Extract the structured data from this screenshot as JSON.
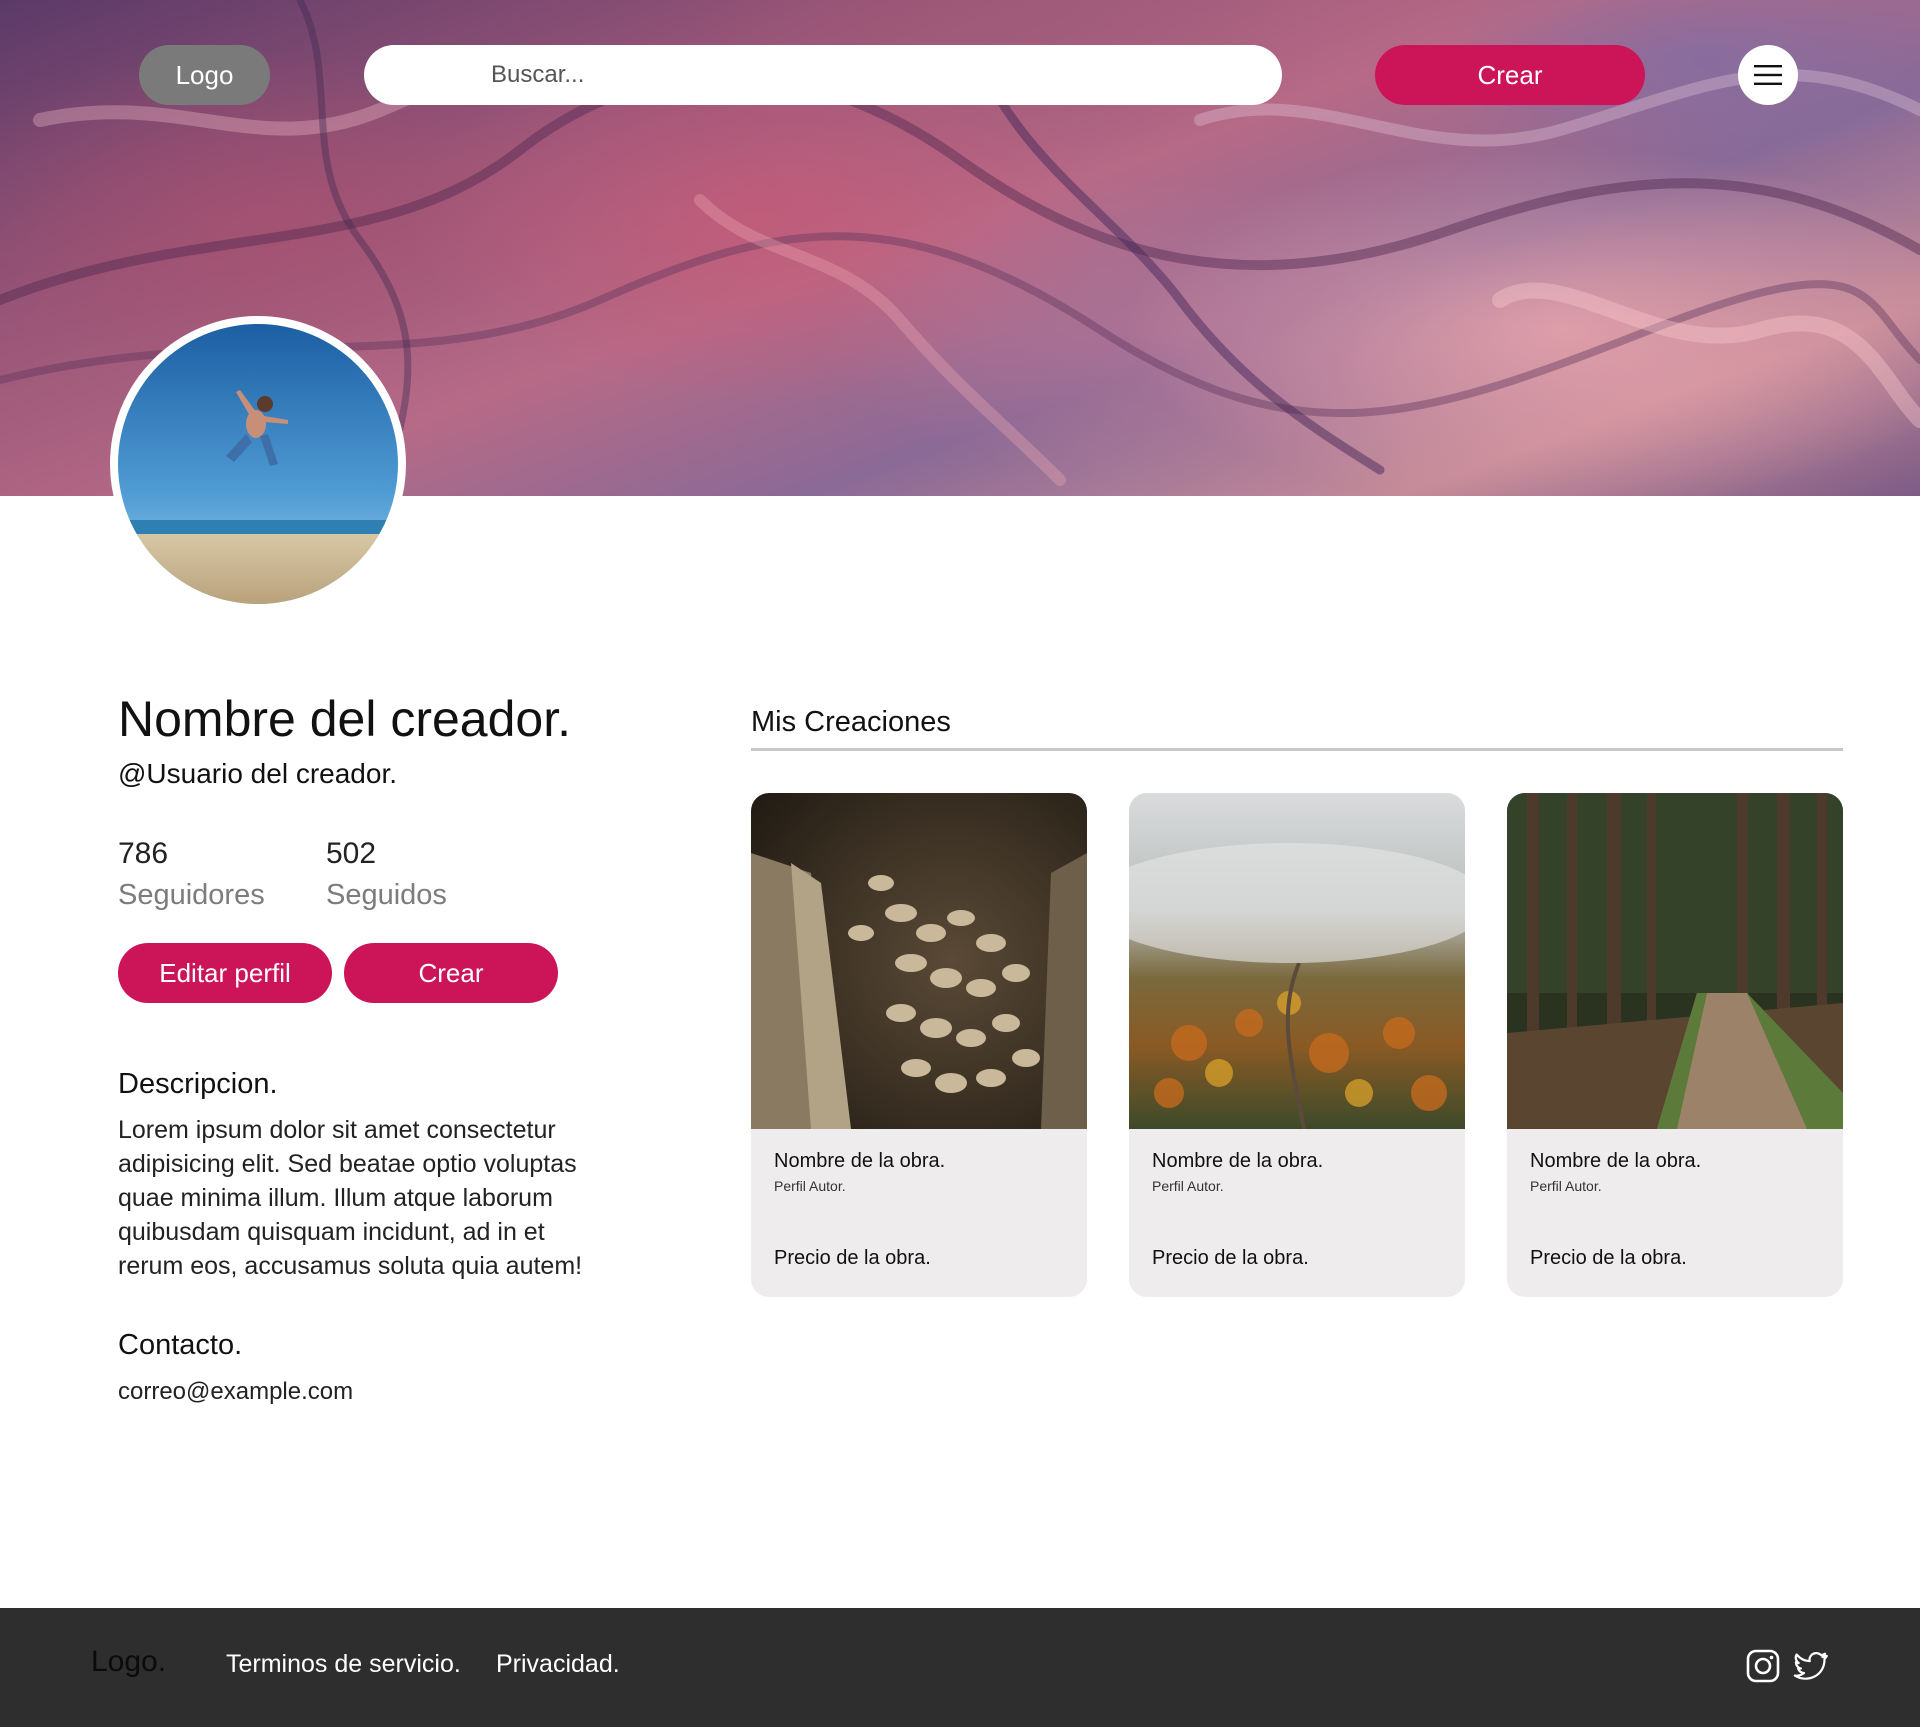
{
  "nav": {
    "logo": "Logo",
    "search_placeholder": "Buscar...",
    "create_label": "Crear",
    "menu_icon": "hamburger-icon"
  },
  "profile": {
    "name": "Nombre del creador.",
    "username": "@Usuario del creador.",
    "followers_count": "786",
    "followers_label": "Seguidores",
    "following_count": "502",
    "following_label": "Seguidos",
    "edit_button": "Editar perfil",
    "create_button": "Crear",
    "description_title": "Descripcion.",
    "description": "Lorem ipsum dolor sit amet consectetur adipisicing elit. Sed beatae optio voluptas quae minima illum. Illum atque laborum quibusdam quisquam incidunt, ad in et rerum eos, accusamus soluta quia autem!",
    "contact_title": "Contacto.",
    "email": "correo@example.com"
  },
  "creations": {
    "title": "Mis Creaciones",
    "cards": [
      {
        "title": "Nombre de la obra.",
        "author": "Perfil Autor.",
        "price": "Precio de la obra.",
        "image": "mushrooms"
      },
      {
        "title": "Nombre de la obra.",
        "author": "Perfil Autor.",
        "price": "Precio de la obra.",
        "image": "misty-autumn-forest"
      },
      {
        "title": "Nombre de la obra.",
        "author": "Perfil Autor.",
        "price": "Precio de la obra.",
        "image": "forest-path"
      }
    ]
  },
  "footer": {
    "logo": "Logo.",
    "terms": "Terminos de servicio.",
    "privacy": "Privacidad.",
    "social_icons": [
      "instagram-icon",
      "twitter-icon"
    ]
  },
  "colors": {
    "accent": "#cc1458",
    "footer_bg": "#2e2e2e",
    "card_bg": "#eeeced",
    "logo_pill": "#7a7a7a"
  }
}
